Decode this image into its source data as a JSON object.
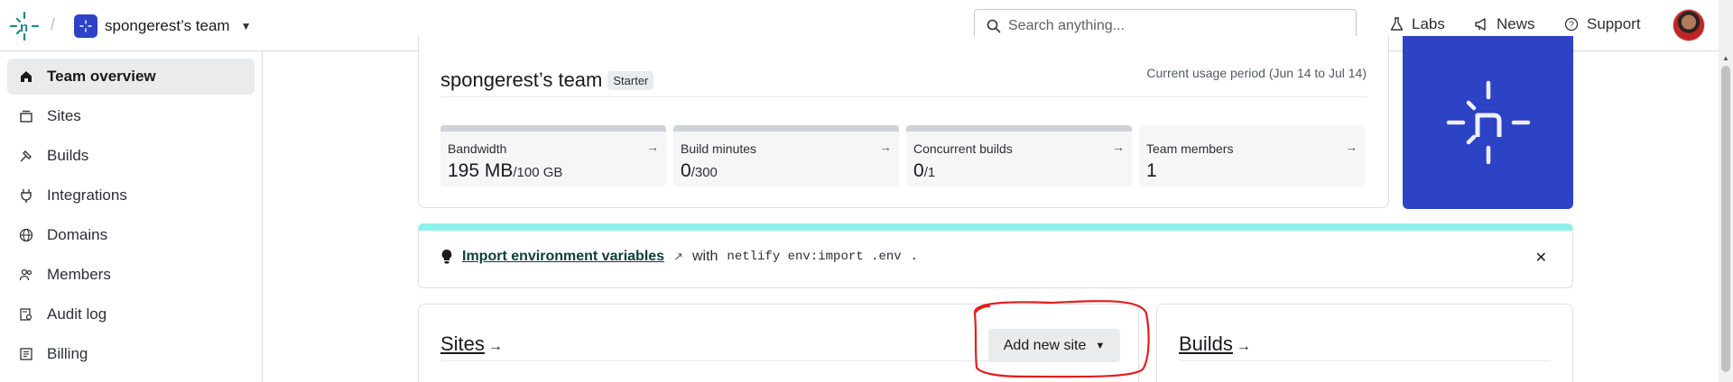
{
  "header": {
    "team_name": "spongerest’s team",
    "search_placeholder": "Search anything...",
    "nav": [
      {
        "label": "Labs",
        "icon": "flask-icon"
      },
      {
        "label": "News",
        "icon": "megaphone-icon"
      },
      {
        "label": "Support",
        "icon": "help-circle-icon"
      }
    ]
  },
  "sidebar": {
    "items": [
      {
        "label": "Team overview",
        "icon": "home-icon",
        "active": true
      },
      {
        "label": "Sites",
        "icon": "sites-icon"
      },
      {
        "label": "Builds",
        "icon": "builds-icon"
      },
      {
        "label": "Integrations",
        "icon": "plug-icon"
      },
      {
        "label": "Domains",
        "icon": "globe-icon"
      },
      {
        "label": "Members",
        "icon": "users-icon"
      },
      {
        "label": "Audit log",
        "icon": "audit-log-icon"
      },
      {
        "label": "Billing",
        "icon": "billing-icon"
      }
    ]
  },
  "usage": {
    "title": "spongerest’s team",
    "plan_badge": "Starter",
    "period": "Current usage period (Jun 14 to Jul 14)",
    "metrics": [
      {
        "label": "Bandwidth",
        "value": "195 MB",
        "limit": "/100 GB"
      },
      {
        "label": "Build minutes",
        "value": "0",
        "limit": "/300"
      },
      {
        "label": "Concurrent builds",
        "value": "0",
        "limit": "/1"
      },
      {
        "label": "Team members",
        "value": "1",
        "limit": ""
      }
    ],
    "arrow": "→"
  },
  "banner": {
    "link_text": "Import environment variables",
    "with_text": "with",
    "command": "netlify env:import .env",
    "trailing": ".",
    "close": "✕"
  },
  "sites": {
    "title": "Sites",
    "arrow": "→",
    "add_button": "Add new site"
  },
  "builds": {
    "title": "Builds",
    "arrow": "→"
  },
  "colors": {
    "brand": "#2d43c6",
    "banner_accent": "#8ef1eb",
    "annotation": "#e0201b"
  }
}
